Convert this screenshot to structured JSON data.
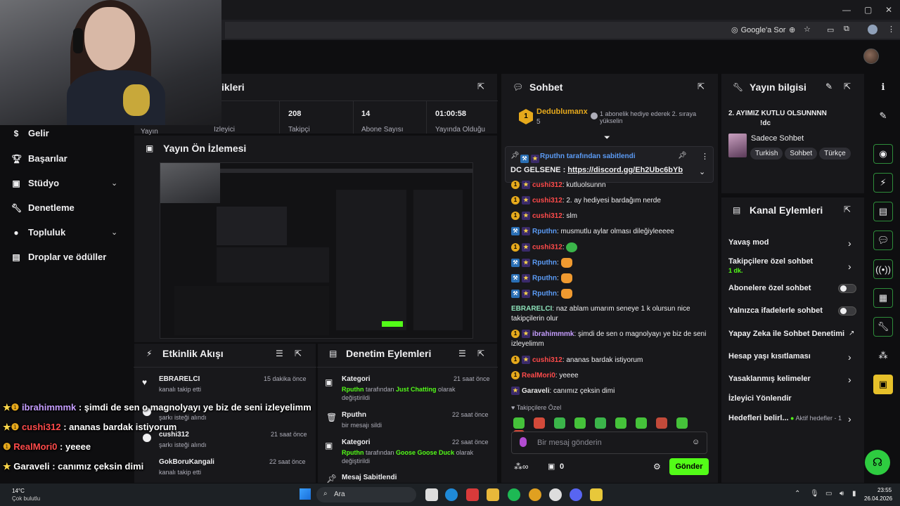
{
  "browser": {
    "google_sor": "Google'a Sor",
    "window_controls": [
      "—",
      "▢",
      "✕"
    ]
  },
  "sidebar": {
    "items": [
      {
        "label": "Gelir",
        "icon": "dollar-icon"
      },
      {
        "label": "Başarılar",
        "icon": "trophy-icon"
      },
      {
        "label": "Stüdyo",
        "icon": "studio-icon"
      },
      {
        "label": "Denetleme",
        "icon": "wrench-icon"
      },
      {
        "label": "Topluluk",
        "icon": "community-icon"
      },
      {
        "label": "Droplar ve ödüller",
        "icon": "drops-icon"
      }
    ]
  },
  "stats": {
    "title_partial": "ikleri",
    "items": [
      {
        "value": "",
        "label": "Izleyici"
      },
      {
        "value": "208",
        "label": "Takipçi"
      },
      {
        "value": "14",
        "label": "Abone Sayısı"
      },
      {
        "value": "01:00:58",
        "label": "Yayında Olduğu"
      }
    ],
    "first_label": "Yayın"
  },
  "preview": {
    "title": "Yayın Ön İzlemesi"
  },
  "activity": {
    "title": "Etkinlik Akışı",
    "events": [
      {
        "user": "EBRARELCI",
        "desc": "kanalı takip etti",
        "time": "15 dakika önce"
      },
      {
        "user": "",
        "desc": "şarkı isteği alındı",
        "time": ""
      },
      {
        "user": "cushi312",
        "desc": "şarkı isteği alındı",
        "time": "21 saat önce"
      },
      {
        "user": "GokBoruKangali",
        "desc": "kanalı takip etti",
        "time": "22 saat önce"
      }
    ]
  },
  "moderation": {
    "title": "Denetim Eylemleri",
    "events": [
      {
        "title": "Kategori",
        "time": "21 saat önce",
        "user": "Rputhn",
        "mid": " tarafından ",
        "target": "Just Chatting",
        "tail": " olarak",
        "line2": "değiştirildi"
      },
      {
        "title": "Rputhn",
        "time": "22 saat önce",
        "desc": "bir mesajı sildi"
      },
      {
        "title": "Kategori",
        "time": "22 saat önce",
        "user": "Rputhn",
        "mid": " tarafından ",
        "target": "Goose Goose Duck",
        "tail": " olarak",
        "line2": "değiştirildi"
      },
      {
        "title": "Mesaj Sabitlendi",
        "time": ""
      }
    ]
  },
  "chat": {
    "title": "Sohbet",
    "gift": {
      "rank": "1",
      "user": "Dedublumanx",
      "count": "5",
      "text": "1 abonelik hediye ederek 2. sıraya yükselin"
    },
    "pinned": {
      "by": "Rputhn tarafından sabitlendi",
      "text": "DC GELSENE : ",
      "link": "https://discord.gg/Eh2Ubc6bYb"
    },
    "messages": [
      {
        "user": "cushi312",
        "color": "red",
        "text": ": kutluolsunnn"
      },
      {
        "user": "cushi312",
        "color": "red",
        "text": ": 2. ay hediyesi bardağım nerde"
      },
      {
        "user": "cushi312",
        "color": "red",
        "text": ": slm"
      },
      {
        "user": "Rputhn",
        "color": "blue",
        "text": ": musmutlu aylar olması dileğiyleeeee"
      },
      {
        "user": "cushi312",
        "color": "red",
        "text": ":"
      },
      {
        "user": "Rputhn",
        "color": "blue",
        "text": ":"
      },
      {
        "user": "Rputhn",
        "color": "blue",
        "text": ":"
      },
      {
        "user": "Rputhn",
        "color": "blue",
        "text": ":"
      },
      {
        "user": "EBRARELCI",
        "color": "green",
        "text": ": naz ablam umarım seneye 1 k olursun nice takipçilerin olur"
      },
      {
        "user": "ibrahimmmk",
        "color": "purple",
        "text": ": şimdi de sen o magnolyayı ye biz de seni izleyelimm"
      },
      {
        "user": "cushi312",
        "color": "red",
        "text": ": ananas bardak istiyorum"
      },
      {
        "user": "RealMori0",
        "color": "red",
        "text": ": yeeee"
      },
      {
        "user": "Garaveli",
        "color": "white",
        "text": ": canımız çeksin dimi"
      }
    ],
    "followers_only": "Takipçilere Özel",
    "input_placeholder": "Bir mesaj gönderin",
    "points": "0",
    "send": "Gönder"
  },
  "stream_info": {
    "title": "Yayın bilgisi",
    "stream_title": "2. AYIMIZ KUTLU OLSUNNNN",
    "stream_title2": "!dc",
    "category": "Sadece Sohbet",
    "tags": [
      "Turkish",
      "Sohbet",
      "Türkçe"
    ]
  },
  "channel_actions": {
    "title": "Kanal Eylemleri",
    "rows": [
      {
        "label": "Yavaş mod",
        "kind": "arrow"
      },
      {
        "label": "Takipçilere özel sohbet",
        "sub": "1 dk.",
        "kind": "arrow"
      },
      {
        "label": "Abonelere özel sohbet",
        "kind": "toggle"
      },
      {
        "label": "Yalnızca ifadelerle sohbet",
        "kind": "toggle"
      },
      {
        "label": "Yapay Zeka ile Sohbet Denetimi",
        "kind": "ext"
      },
      {
        "label": "Hesap yaşı kısıtlaması",
        "kind": "arrow"
      },
      {
        "label": "Yasaklanmış kelimeler",
        "kind": "arrow"
      },
      {
        "label": "İzleyici Yönlendir",
        "kind": "none"
      },
      {
        "label": "Hedefleri belirl...",
        "sub": "Aktif hedefler - 1",
        "kind": "arrow"
      }
    ]
  },
  "overlay": {
    "lines": [
      {
        "user": "ibrahimmmk",
        "text": " : şimdi de sen o magnolyayı ye biz de seni izleyelimm",
        "color": "#c59dff"
      },
      {
        "user": "cushi312",
        "text": " : ananas bardak istiyorum",
        "color": "#ff4b4b"
      },
      {
        "user": "RealMori0",
        "text": " : yeeee",
        "color": "#ff4b4b"
      },
      {
        "user": "Garaveli",
        "text": " : canımız çeksin dimi",
        "color": "#ffffff"
      }
    ]
  },
  "taskbar": {
    "weather_temp": "14°C",
    "weather_desc": "Çok bulutlu",
    "search": "Ara",
    "time": "23:55",
    "date": "26.04.2026"
  },
  "colors": {
    "accent": "#53fc18",
    "panel": "#18181b",
    "bg": "#0e0e10"
  }
}
